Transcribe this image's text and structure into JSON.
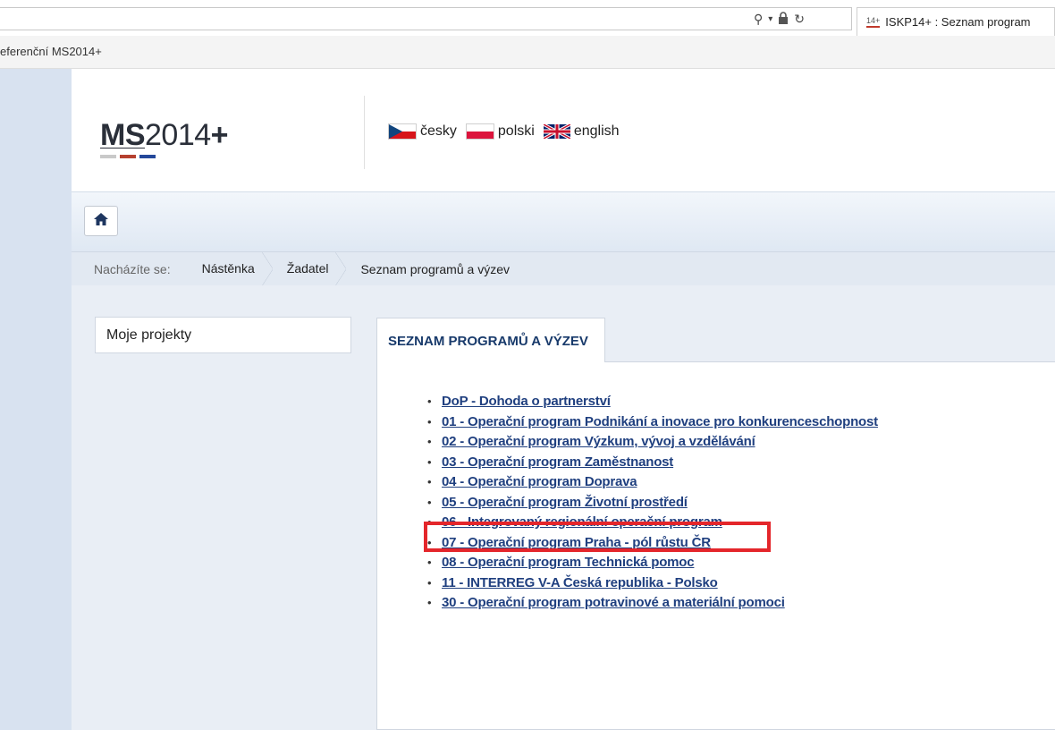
{
  "browser": {
    "tab_title": "ISKP14+ : Seznam program",
    "tab_favicon_text": "14+",
    "favorites_label": "eferenční MS2014+"
  },
  "header": {
    "logo_bold": "MS",
    "logo_rest": "2014",
    "logo_plus": "+",
    "logo_bar_colors": [
      "#c9c9c9",
      "#b5402f",
      "#24489a"
    ],
    "languages": [
      {
        "label": "česky",
        "flag": "cz-flag-icon"
      },
      {
        "label": "polski",
        "flag": "pl-flag-icon"
      },
      {
        "label": "english",
        "flag": "uk-flag-icon"
      }
    ]
  },
  "breadcrumb": {
    "prefix": "Nacházíte se:",
    "items": [
      "Nástěnka",
      "Žadatel"
    ],
    "current": "Seznam programů a výzev"
  },
  "sidebar": {
    "moje_projekty": "Moje projekty"
  },
  "main": {
    "tab_label": "SEZNAM PROGRAMŮ A VÝZEV",
    "programs": [
      "DoP - Dohoda o partnerství",
      "01 - Operační program Podnikání a inovace pro konkurenceschopnost",
      "02 - Operační program Výzkum, vývoj a vzdělávání",
      "03 - Operační program Zaměstnanost",
      "04 - Operační program Doprava",
      "05 - Operační program Životní prostředí",
      "06 - Integrovaný regionální operační program",
      "07 - Operační program Praha - pól růstu ČR",
      "08 - Operační program Technická pomoc",
      "11 - INTERREG V-A Česká republika - Polsko",
      "30 - Operační program potravinové a materiální pomoci"
    ]
  },
  "colors": {
    "link": "#1f3f7f",
    "highlight": "#e4262b",
    "sidebar_strip": "#d8e2f0"
  }
}
